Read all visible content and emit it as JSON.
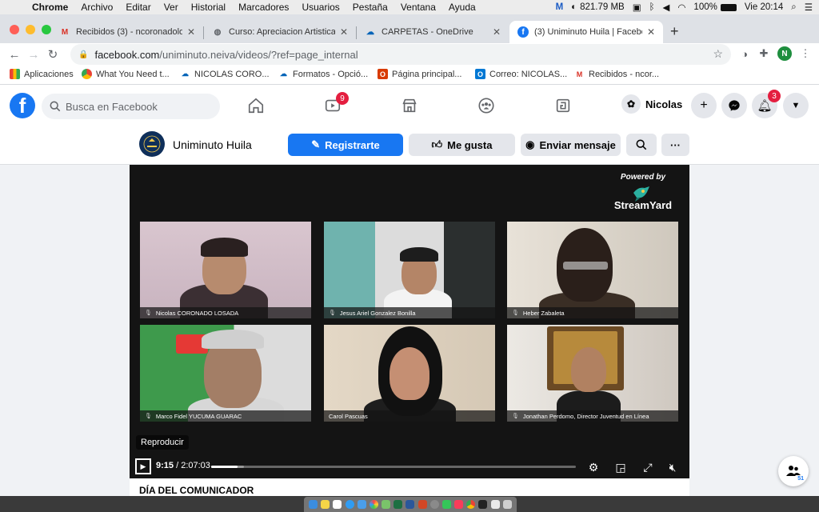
{
  "menubar": {
    "app": "Chrome",
    "items": [
      "Archivo",
      "Editar",
      "Ver",
      "Historial",
      "Marcadores",
      "Usuarios",
      "Pestaña",
      "Ventana",
      "Ayuda"
    ],
    "memory": "821.79 MB",
    "battery": "100%",
    "clock": "Vie 20:14"
  },
  "tabs": [
    {
      "title": "Recibidos (3) - ncoronadolo@u",
      "icon": "gmail-icon",
      "color": "#d93025",
      "active": false
    },
    {
      "title": "Curso: Apreciacion Artistica",
      "icon": "globe-icon",
      "color": "#5f6368",
      "active": false
    },
    {
      "title": "CARPETAS - OneDrive",
      "icon": "onedrive-icon",
      "color": "#0364b8",
      "active": false
    },
    {
      "title": "(3) Uniminuto Huila | Facebook",
      "icon": "facebook-icon",
      "color": "#1877f2",
      "active": true
    }
  ],
  "address": {
    "host": "facebook.com",
    "path": "/uniminuto.neiva/videos/?ref=page_internal",
    "profile_initial": "N"
  },
  "bookmarks": [
    {
      "label": "Aplicaciones",
      "icon": "apps-grid-icon"
    },
    {
      "label": "What You Need t...",
      "icon": "chrome-icon"
    },
    {
      "label": "NICOLAS CORO...",
      "icon": "onedrive-icon"
    },
    {
      "label": "Formatos - Opció...",
      "icon": "onedrive-icon"
    },
    {
      "label": "Página principal...",
      "icon": "office-icon"
    },
    {
      "label": "Correo: NICOLAS...",
      "icon": "outlook-icon"
    },
    {
      "label": "Recibidos - ncor...",
      "icon": "gmail-icon"
    }
  ],
  "facebook": {
    "search_placeholder": "Busca en Facebook",
    "watch_badge": "9",
    "notifications_badge": "3",
    "profile_name": "Nicolas",
    "brand_color": "#1877f2"
  },
  "page": {
    "name": "Uniminuto Huila",
    "register_label": "Registrarte",
    "like_label": "Me gusta",
    "message_label": "Enviar mensaje"
  },
  "video": {
    "powered_by": "Powered by",
    "brand": "StreamYard",
    "participants": [
      "Nicolas CORONADO LOSADA",
      "Jesus Ariel Gonzalez Bonilla",
      "Heber Zabaleta",
      "Marco Fidel YUCUMA GUARAC",
      "Carol Pascuas",
      "Jonathan Perdomo, Director Juventud en Línea"
    ],
    "replay_label": "Reproducir",
    "current_time": "9:15",
    "total_time": "2:07:03",
    "progress_fraction": 0.072,
    "buffer_fraction": 0.09
  },
  "post": {
    "title": "DÍA DEL COMUNICADOR"
  },
  "chat": {
    "online_count": "51"
  }
}
